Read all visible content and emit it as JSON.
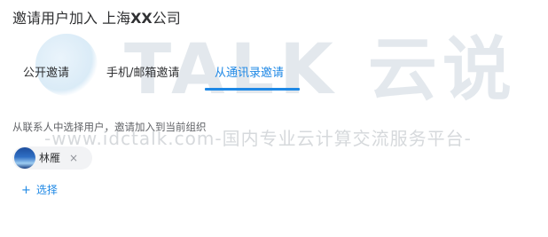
{
  "watermark": {
    "brand": "TALK 云说",
    "url": "-www.idctalk.com-国内专业云计算交流服务平台-"
  },
  "dialog": {
    "title_prefix": "邀请用户加入 上海",
    "title_company": "XX",
    "title_suffix": "公司"
  },
  "tabs": [
    {
      "label": "公开邀请",
      "active": false
    },
    {
      "label": "手机/邮箱邀请",
      "active": false
    },
    {
      "label": "从通讯录邀请",
      "active": true
    }
  ],
  "hint": "从联系人中选择用户，邀请加入到当前组织",
  "selected_users": [
    {
      "name": "林雁",
      "remove_icon": "×"
    }
  ],
  "select_button": {
    "icon": "+",
    "label": "选择"
  },
  "colors": {
    "accent": "#1e88e5",
    "text": "#303133",
    "muted": "#606266",
    "chip_bg": "#f2f3f5"
  }
}
